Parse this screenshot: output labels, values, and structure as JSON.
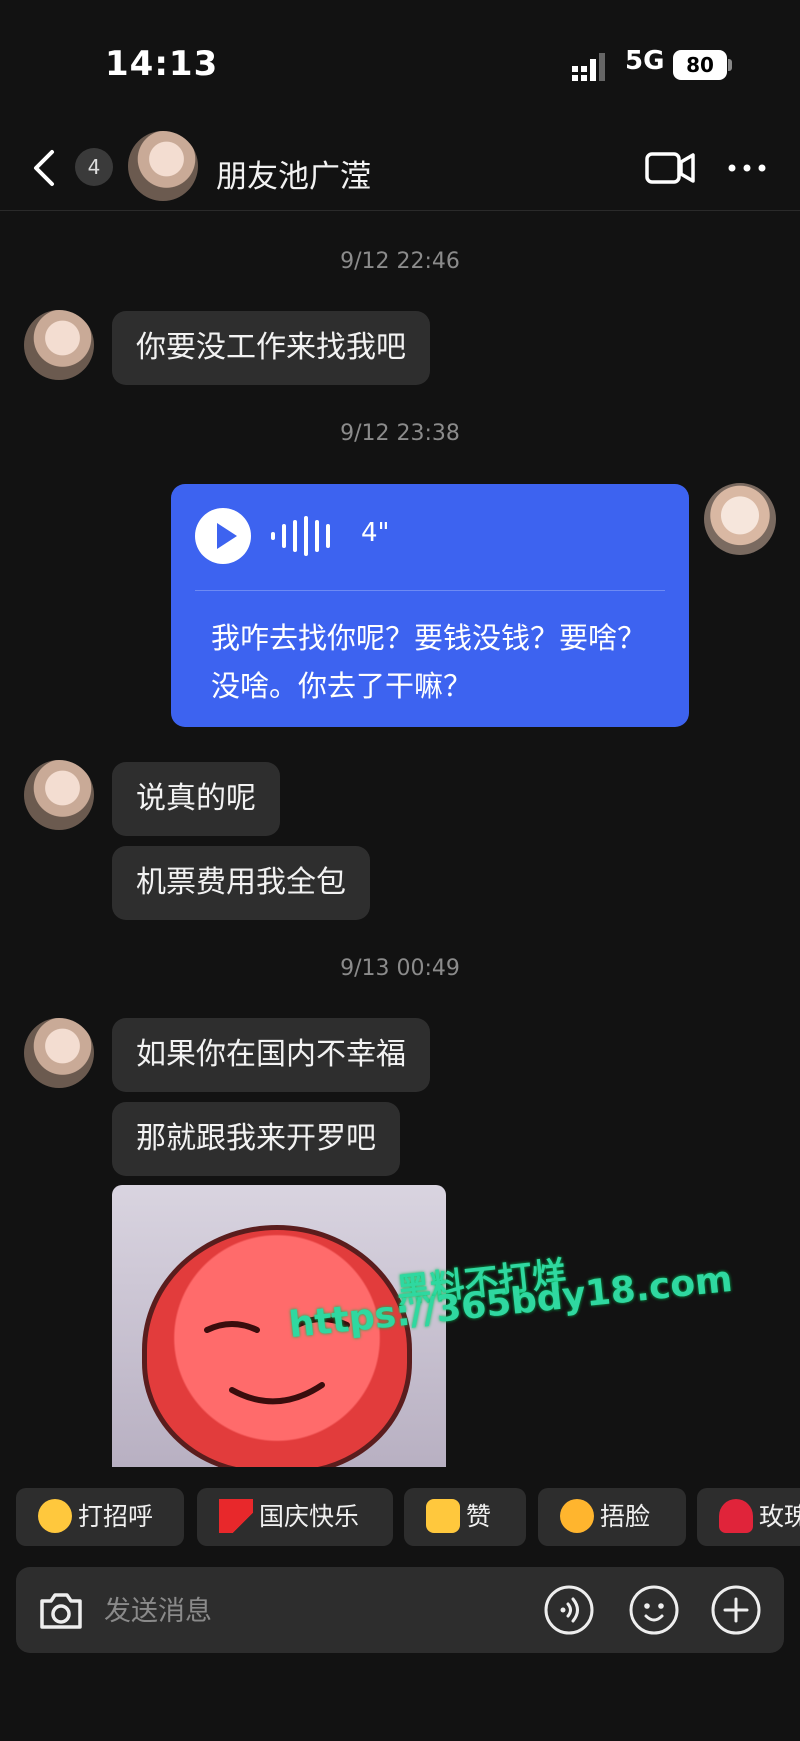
{
  "status_bar": {
    "time": "14:13",
    "network": "5G",
    "battery": "80"
  },
  "header": {
    "unread_count": "4",
    "contact_name": "朋友池广滢"
  },
  "messages": {
    "ts1": "9/12 22:46",
    "m1": "你要没工作来找我吧",
    "ts2": "9/12 23:38",
    "voice": {
      "duration": "4\"",
      "transcript": "我咋去找你呢？要钱没钱？要啥？没啥。你去了干嘛？"
    },
    "m2": "说真的呢",
    "m3": "机票费用我全包",
    "ts3": "9/13 00:49",
    "m4": "如果你在国内不幸福",
    "m5": "那就跟我来开罗吧"
  },
  "watermark": {
    "line1": "黑料不打烊",
    "line2": "https://365bdy18.com"
  },
  "quick_replies": [
    {
      "label": "打招呼",
      "icon": "waving-face-icon"
    },
    {
      "label": "国庆快乐",
      "icon": "red-flag-icon"
    },
    {
      "label": "赞",
      "icon": "thumbs-up-icon"
    },
    {
      "label": "捂脸",
      "icon": "facepalm-laugh-icon"
    },
    {
      "label": "玫瑰",
      "icon": "rose-icon"
    }
  ],
  "composer": {
    "placeholder": "发送消息"
  },
  "colors": {
    "background": "#121212",
    "bubble": "#2e2e2e",
    "voice_card": "#3d63f0",
    "watermark": "#2fd8a0"
  }
}
